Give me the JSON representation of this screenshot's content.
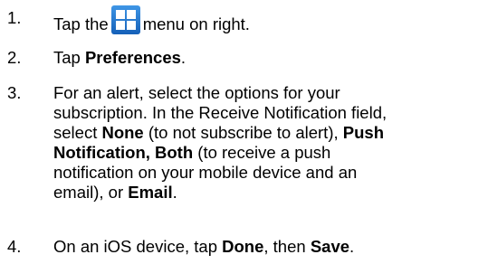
{
  "steps": [
    {
      "number": "1.",
      "before_icon": "Tap the",
      "icon": "grid-menu-icon",
      "after_icon": "menu on right."
    },
    {
      "number": "2.",
      "prefix": "Tap ",
      "bold": "Preferences",
      "suffix": "."
    },
    {
      "number": "3.",
      "lines": {
        "l1": "For an alert, select the options for your",
        "l2": "subscription. In the Receive Notification field,",
        "l3_pre": "select ",
        "l3_b1": "None",
        "l3_mid": " (to not subscribe to alert), ",
        "l3_b2": "Push",
        "l4_b1": "Notification, Both",
        "l4_post": " (to receive a push",
        "l5": "notification on your mobile device and an",
        "l6_pre": "email), or ",
        "l6_b": "Email",
        "l6_post": "."
      }
    },
    {
      "number": "4.",
      "prefix": "On an iOS device, tap ",
      "bold1": "Done",
      "mid": ", then ",
      "bold2": "Save",
      "suffix": "."
    }
  ],
  "colors": {
    "text": "#000000",
    "icon_bg": "#1e73c8",
    "icon_squares": "#ffffff"
  }
}
